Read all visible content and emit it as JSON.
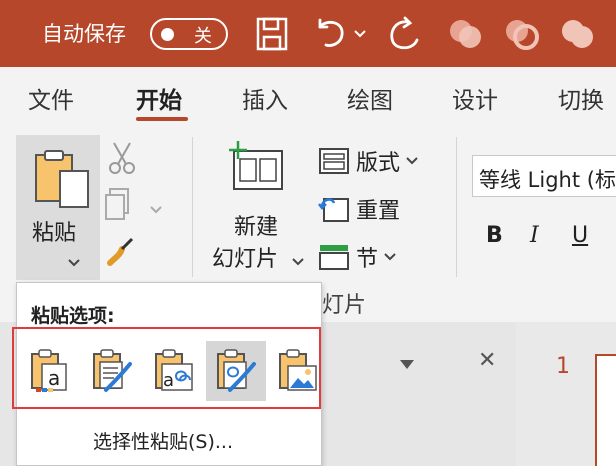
{
  "titlebar": {
    "autosave_label": "自动保存",
    "toggle_state": "关",
    "bg_color": "#b7472a"
  },
  "tabs": [
    {
      "label": "文件"
    },
    {
      "label": "开始",
      "active": true
    },
    {
      "label": "插入"
    },
    {
      "label": "绘图"
    },
    {
      "label": "设计"
    },
    {
      "label": "切换"
    }
  ],
  "ribbon": {
    "paste_label": "粘贴",
    "new_slide_line1": "新建",
    "new_slide_line2": "幻灯片",
    "layout_label": "版式",
    "reset_label": "重置",
    "section_label": "节",
    "group_label": "灯片",
    "font_name": "等线 Light (标",
    "bold": "B",
    "italic": "I",
    "underline": "U"
  },
  "paste_menu": {
    "heading": "粘贴选项:",
    "options": [
      {
        "icon": "paste-use-destination-theme-icon"
      },
      {
        "icon": "paste-keep-source-formatting-icon"
      },
      {
        "icon": "paste-embed-icon"
      },
      {
        "icon": "paste-keep-source-formatting-selected-icon",
        "selected": true
      },
      {
        "icon": "paste-picture-icon"
      }
    ],
    "paste_special": "选择性粘贴(S)..."
  },
  "slides_pane": {
    "slide_number": "1"
  },
  "colors": {
    "accent": "#b7472a",
    "highlight_border": "#e03c3c"
  }
}
